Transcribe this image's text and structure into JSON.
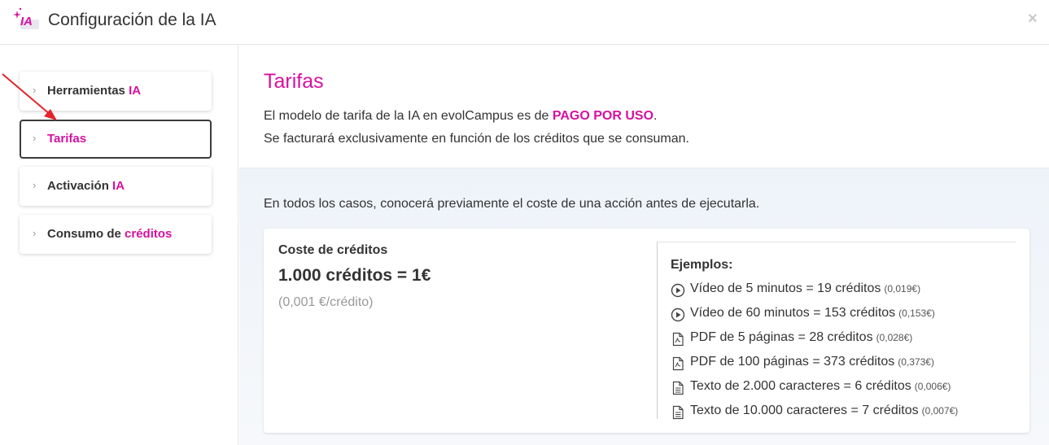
{
  "header": {
    "logo_text": "IA",
    "title": "Configuración de la IA",
    "close_label": "×"
  },
  "sidebar": {
    "items": [
      {
        "prefix": "Herramientas ",
        "highlight": "IA",
        "active": false
      },
      {
        "prefix": "",
        "highlight": "Tarifas",
        "active": true
      },
      {
        "prefix": "Activación ",
        "highlight": "IA",
        "active": false
      },
      {
        "prefix": "Consumo de ",
        "highlight": "créditos",
        "active": false
      }
    ],
    "chevron": "›"
  },
  "main": {
    "title": "Tarifas",
    "desc_line1_prefix": "El modelo de tarifa de la IA en evolCampus es de ",
    "desc_line1_highlight": "PAGO POR USO",
    "desc_line1_suffix": ".",
    "desc_line2": "Se facturará exclusivamente en función de los créditos que se consuman.",
    "note": "En todos los casos, conocerá previamente el coste de una acción antes de ejecutarla."
  },
  "cost": {
    "heading": "Coste de créditos",
    "main": "1.000 créditos = 1€",
    "sub": "(0,001 €/crédito)"
  },
  "examples": {
    "heading": "Ejemplos:",
    "rows": [
      {
        "icon": "play-circle-icon",
        "text": "Vídeo de 5 minutos = 19 créditos",
        "price": "(0,019€)"
      },
      {
        "icon": "play-circle-icon",
        "text": "Vídeo de 60 minutos = 153 créditos",
        "price": "(0,153€)"
      },
      {
        "icon": "pdf-file-icon",
        "text": "PDF de 5 páginas = 28 créditos",
        "price": "(0,028€)"
      },
      {
        "icon": "pdf-file-icon",
        "text": "PDF de 100 páginas = 373 créditos",
        "price": "(0,373€)"
      },
      {
        "icon": "text-file-icon",
        "text": "Texto de 2.000 caracteres = 6 créditos",
        "price": "(0,006€)"
      },
      {
        "icon": "text-file-icon",
        "text": "Texto de 10.000 caracteres = 7 créditos",
        "price": "(0,007€)"
      }
    ]
  },
  "colors": {
    "accent": "#d6119f",
    "arrow": "#e3242b"
  }
}
